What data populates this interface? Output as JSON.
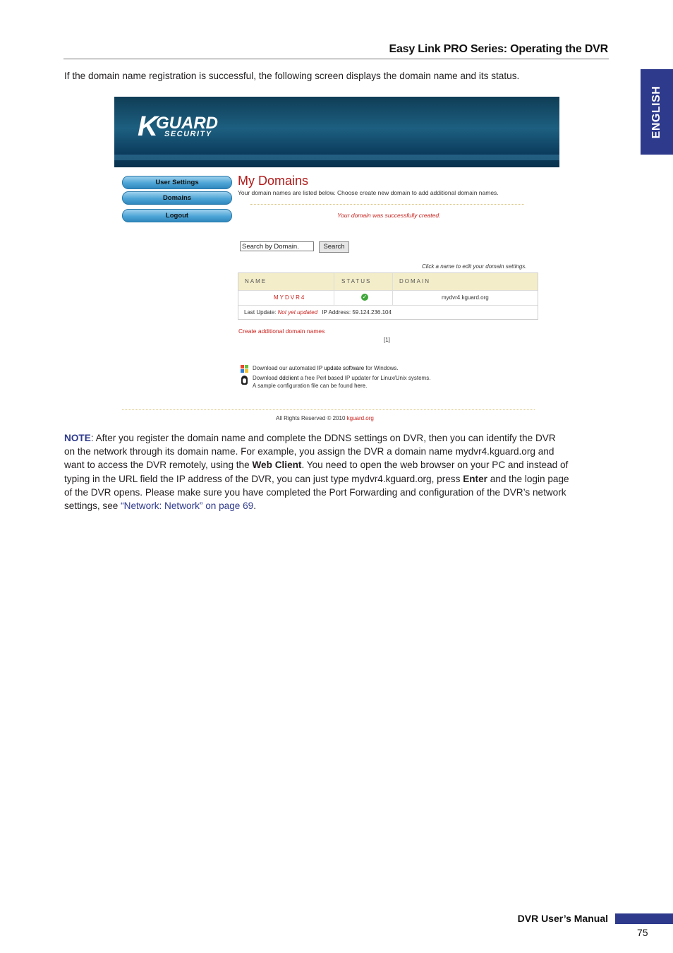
{
  "header": {
    "title": "Easy Link PRO Series: Operating the DVR",
    "language_tab": "ENGLISH"
  },
  "intro_text": "If the domain name registration is successful, the following screen displays the domain name and its status.",
  "screenshot": {
    "logo": {
      "k": "K",
      "guard": "GUARD",
      "security": "SECURITY"
    },
    "nav": [
      "User Settings",
      "Domains",
      "Logout"
    ],
    "page_title": "My Domains",
    "subtitle": "Your domain names are listed below. Choose create new domain to add additional domain names.",
    "success_msg": "Your domain was successfully created.",
    "search_input_value": "Search by Domain.",
    "search_button": "Search",
    "click_note": "Click a name to edit your domain settings.",
    "table": {
      "headers": [
        "NAME",
        "STATUS",
        "DOMAIN"
      ],
      "row": {
        "name": "MYDVR4",
        "status_icon": "check-icon",
        "domain": "mydvr4.kguard.org"
      },
      "last_update_label": "Last Update:",
      "last_update_value": "Not yet updated",
      "ip_label": "IP Address:",
      "ip_value": "59.124.236.104"
    },
    "create_link": "Create additional domain names",
    "pager": "[1]",
    "download1": {
      "pre": "Download our automated ",
      "link": "IP update software",
      "post": " for Windows."
    },
    "download2": {
      "pre": "Download ",
      "link": "ddclient",
      "post": " a free Perl based IP updater for Linux/Unix systems."
    },
    "download3": {
      "pre": "A sample configuration file can be found ",
      "link": "here",
      "post": "."
    },
    "copyright": "All Rights Reserved © 2010 ",
    "copyright_link": "kguard.org"
  },
  "note": {
    "label": "NOTE",
    "line1_a": ": After you register the domain name and complete the DDNS settings on DVR, then you can identify the DVR",
    "line2": "on the network through its domain name. For example, you assign the DVR a domain name mydvr4.kguard.org and",
    "line3_a": "want to access the DVR remotely, using the ",
    "line3_b": "Web Client",
    "line3_c": ". You need to open the web browser on your PC and instead of",
    "line4_a": "typing in the URL field the IP address of the DVR, you can just type mydvr4.kguard.org, press ",
    "line4_b": "Enter",
    "line4_c": " and the login page",
    "line5": "of the DVR opens. Please make sure you have completed the Port Forwarding and configuration of the DVR’s network",
    "line6_a": "settings, see ",
    "line6_link": "“Network: Network” on page 69",
    "line6_c": "."
  },
  "footer": {
    "title": "DVR User’s Manual",
    "page_number": "75"
  },
  "colors": {
    "accent": "#2e3a8c",
    "banner": "#0f3d56",
    "error_red": "#c8231e"
  }
}
